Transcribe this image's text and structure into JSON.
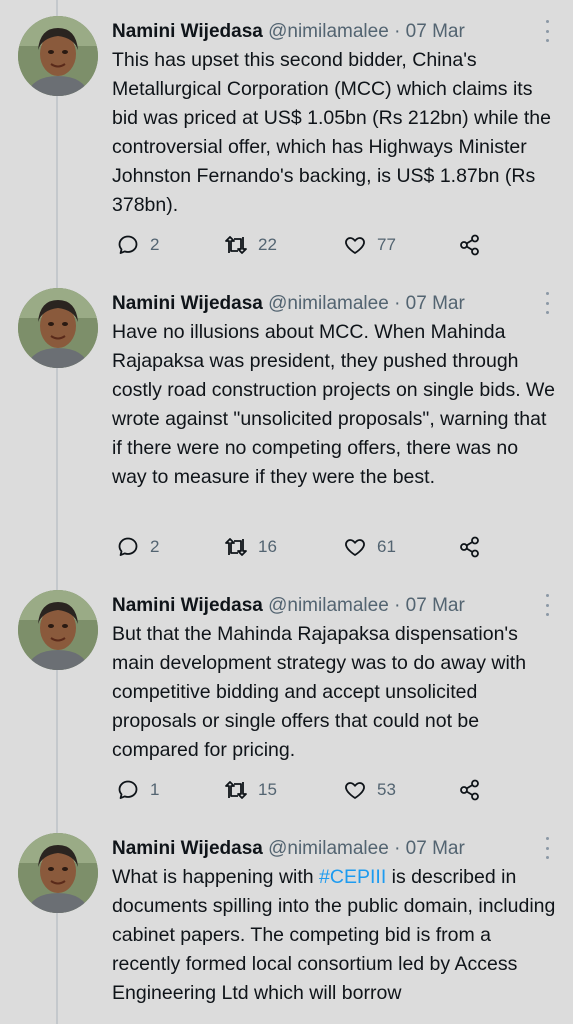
{
  "tweets": [
    {
      "name": "Namini Wijedasa",
      "handle": "@nimilamalee",
      "separator": "·",
      "date": "07 Mar",
      "text": "This has upset this second bidder, China's Metallurgical Corporation (MCC) which claims its bid was priced at US$ 1.05bn (Rs 212bn) while the controversial offer, which has Highways Minister Johnston Fernando's backing, is US$ 1.87bn (Rs 378bn).",
      "replies": "2",
      "retweets": "22",
      "likes": "77"
    },
    {
      "name": "Namini Wijedasa",
      "handle": "@nimilamalee",
      "separator": "·",
      "date": "07 Mar",
      "text": "Have no illusions about MCC. When Mahinda Rajapaksa was president, they pushed through costly road construction projects on single bids. We wrote against \"unsolicited proposals\", warning that if there were no competing offers, there was no way to measure if they were the best.",
      "replies": "2",
      "retweets": "16",
      "likes": "61"
    },
    {
      "name": "Namini Wijedasa",
      "handle": "@nimilamalee",
      "separator": "·",
      "date": "07 Mar",
      "text": "But that the Mahinda Rajapaksa dispensation's main development strategy was to do away with competitive bidding and accept unsolicited proposals or single offers that could not be compared for pricing.",
      "replies": "1",
      "retweets": "15",
      "likes": "53"
    },
    {
      "name": "Namini Wijedasa",
      "handle": "@nimilamalee",
      "separator": "·",
      "date": "07 Mar",
      "text_before": "What is happening with ",
      "hashtag": "#CEPIII",
      "text_after": " is described in documents spilling into the public domain, including cabinet papers. The competing bid is from a recently formed local consortium led by Access Engineering Ltd which will borrow"
    }
  ],
  "icons": {
    "reply": "reply-icon",
    "retweet": "retweet-icon",
    "like": "heart-icon",
    "share": "share-icon",
    "more": "more-options-icon"
  },
  "colors": {
    "background": "#dcdcdc",
    "hashtag": "#1d9bf0",
    "secondary_text": "#536471"
  }
}
